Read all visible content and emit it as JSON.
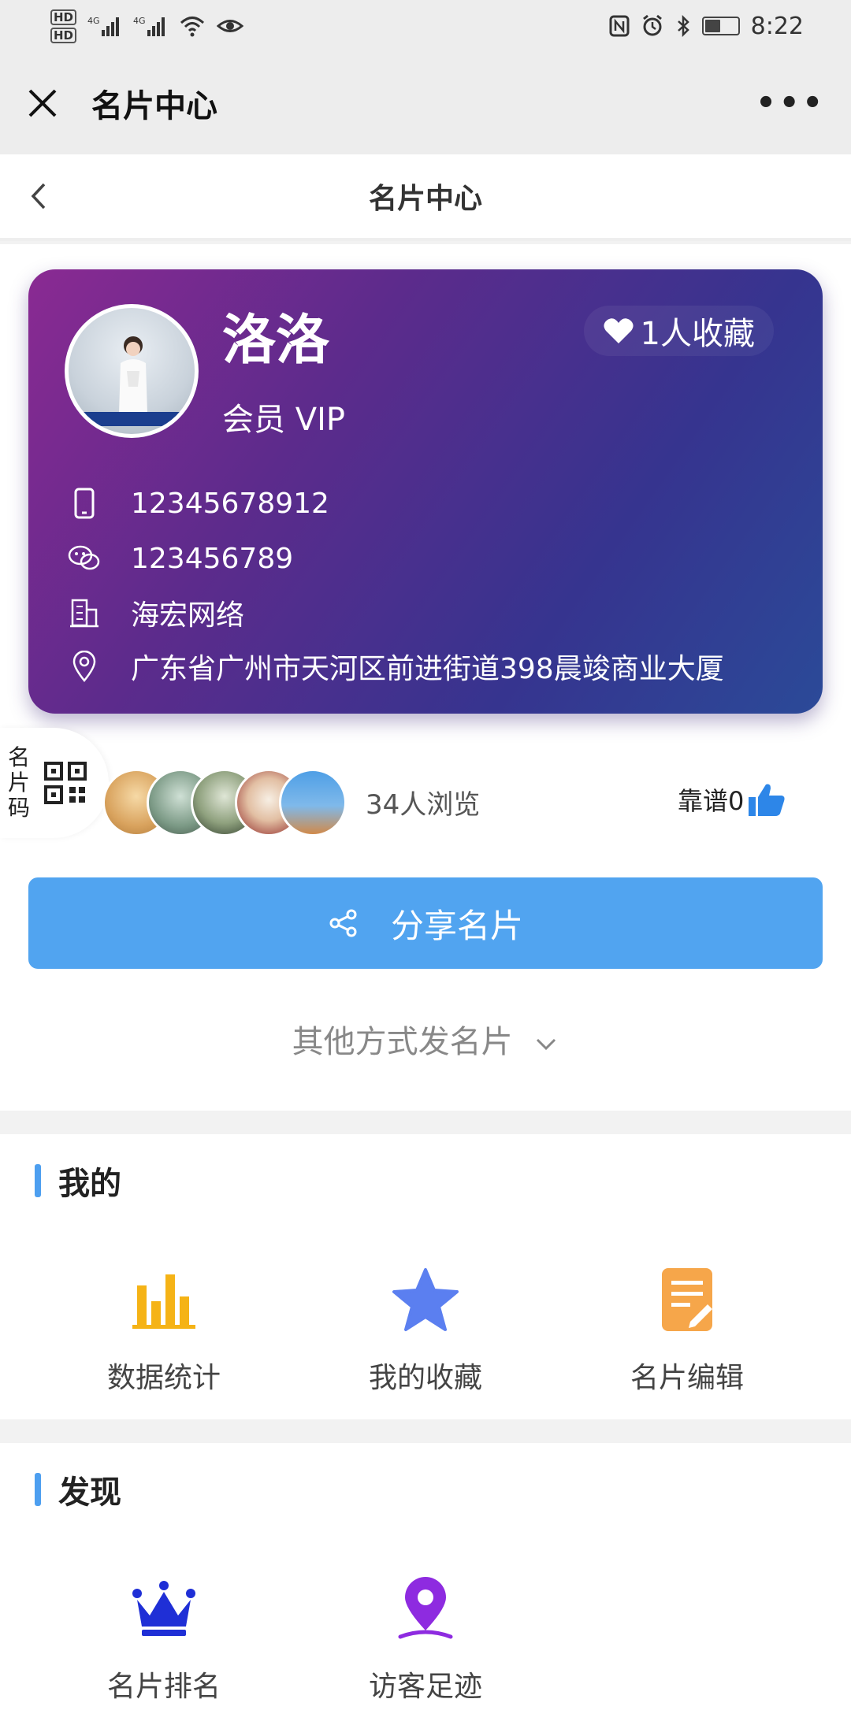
{
  "status_bar": {
    "time": "8:22",
    "network": "4G"
  },
  "wechat_bar": {
    "title": "名片中心",
    "more": "•••"
  },
  "nav": {
    "title": "名片中心"
  },
  "card": {
    "name": "洛洛",
    "favorites": "1人收藏",
    "member": "会员 VIP",
    "phone": "12345678912",
    "wechat": "123456789",
    "company": "海宏网络",
    "address": "广东省广州市天河区前进街道398晨竣商业大厦"
  },
  "qr_tab": {
    "label": "名片码"
  },
  "viewers": {
    "count_text": "34人浏览"
  },
  "kaopu": {
    "label": "靠谱0"
  },
  "share": {
    "label": "分享名片"
  },
  "other_ways": {
    "label": "其他方式发名片"
  },
  "my_section": {
    "title": "我的",
    "items": [
      {
        "label": "数据统计",
        "icon": "bar-chart-icon"
      },
      {
        "label": "我的收藏",
        "icon": "star-icon"
      },
      {
        "label": "名片编辑",
        "icon": "edit-document-icon"
      }
    ]
  },
  "discover_section": {
    "title": "发现",
    "items": [
      {
        "label": "名片排名",
        "icon": "crown-icon"
      },
      {
        "label": "访客足迹",
        "icon": "location-pin-icon"
      }
    ]
  },
  "colors": {
    "accent": "#51a4f0",
    "bar": "#4d9ff0",
    "card_start": "#8a2a92",
    "card_end": "#2b4a98"
  }
}
